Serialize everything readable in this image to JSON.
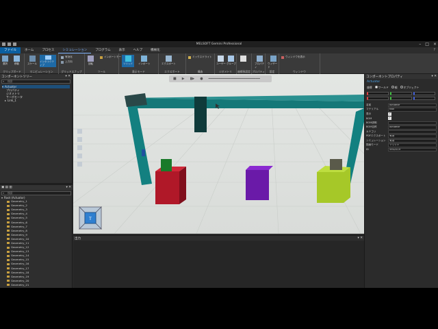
{
  "window": {
    "title": "MELSOFT Gemini Professional"
  },
  "menus": [
    "ファイル",
    "ホーム",
    "プロセス",
    "シミュレーション",
    "プログラム",
    "表示",
    "ヘルプ",
    "機械化"
  ],
  "ribbon": {
    "groups": [
      "クリップボード",
      "マニピュレーション",
      "グリッドスナップ",
      "ツール",
      "構造",
      "表示モード",
      "インポート",
      "エクスポート",
      "構造",
      "ジオメトリ",
      "座標系設定",
      "プロパティ",
      "設定",
      "ウィンドウ"
    ],
    "buttons": [
      "選択",
      "移動",
      "インタラクティブ",
      "スケール",
      "回転",
      "インポート",
      "エクスポート",
      "ユーザー",
      "グループ",
      "ソリッド",
      "プロパティ",
      "ウィザード"
    ],
    "small_items": [
      "有効化",
      "上方向",
      "インポートモード",
      "ミックスドライト",
      "ウィンドウを表示"
    ]
  },
  "left_panel": {
    "title": "コンポーネントツリー",
    "search_placeholder": "検索",
    "tree": [
      "Actuator",
      "プロパティ",
      "ジオメトリ",
      "サーボモータ",
      "Link_1"
    ],
    "search2_placeholder": "検索",
    "root": "Root (Actuator)",
    "geometries": [
      "Geometry_1",
      "Geometry_2",
      "Geometry_3",
      "Geometry_4",
      "Geometry_5",
      "Geometry_6",
      "Geometry_7",
      "Geometry_8",
      "Geometry_9",
      "Geometry_10",
      "Geometry_11",
      "Geometry_12",
      "Geometry_13",
      "Geometry_14",
      "Geometry_15",
      "Geometry_16",
      "Geometry_17",
      "Geometry_18",
      "Geometry_19",
      "Geometry_20",
      "Geometry_21",
      "Geometry_22"
    ]
  },
  "output_panel": {
    "title": "出力"
  },
  "right_panel": {
    "title": "コンポーネントプロパティ",
    "name": "Actuator",
    "coord_label": "座標",
    "coord_options": [
      "ワールド",
      "親",
      "オブジェクト"
    ],
    "props": [
      {
        "key": "名前",
        "value": "Actuator",
        "type": "text"
      },
      {
        "key": "マテリアル",
        "value": "Null",
        "type": "text"
      },
      {
        "key": "表示",
        "value": "✓",
        "type": "check"
      },
      {
        "key": "BOM",
        "value": "✓",
        "type": "check"
      },
      {
        "key": "BOM説明",
        "value": "",
        "type": "text"
      },
      {
        "key": "BOM名称",
        "value": "Actuator",
        "type": "text"
      },
      {
        "key": "カテゴリ",
        "value": "",
        "type": "text"
      },
      {
        "key": "PDFエクスポート",
        "value": "有効",
        "type": "text"
      },
      {
        "key": "シミュレーション",
        "value": "有効",
        "type": "text"
      },
      {
        "key": "描画モード",
        "value": "ソリッド",
        "type": "text"
      },
      {
        "key": "ID",
        "value": "5902519",
        "type": "text"
      }
    ]
  },
  "colors": {
    "accent": "#0a5fa0",
    "teal": "#1a6f6f",
    "red_box": "#b01828",
    "purple_box": "#6a1aa8",
    "lime_box": "#a6c828",
    "green_block": "#1a7a2a"
  }
}
